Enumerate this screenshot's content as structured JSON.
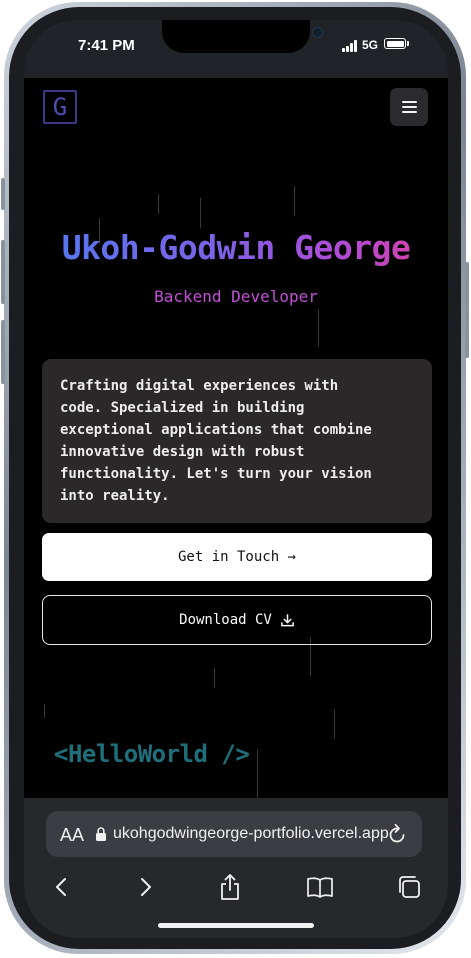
{
  "status_bar": {
    "time": "7:41 PM",
    "network": "5G"
  },
  "header": {
    "logo_letter": "G",
    "menu_icon": "hamburger-icon"
  },
  "hero": {
    "name": "Ukoh-Godwin George",
    "role": "Backend Developer",
    "bio": "Crafting digital experiences with\ncode. Specialized in building\nexceptional applications that combine\ninnovative design with robust\nfunctionality. Let's turn your vision\ninto reality."
  },
  "actions": {
    "contact_label": "Get in Touch →",
    "cv_label": "Download CV",
    "cv_icon": "download-icon"
  },
  "footer_tag": "<HelloWorld />",
  "browser": {
    "text_size_label": "AA",
    "url": "ukohgodwingeorge-portfolio.vercel.app",
    "icons": [
      "back-icon",
      "forward-icon",
      "share-icon",
      "bookmarks-icon",
      "tabs-icon"
    ]
  },
  "colors": {
    "name_gradient_start": "#4f7bf0",
    "name_gradient_end": "#de3f9e",
    "role": "#c24fd6",
    "footer_tag": "#1f6f7b",
    "page_background": "#000000",
    "bio_card": "#2a2829"
  }
}
